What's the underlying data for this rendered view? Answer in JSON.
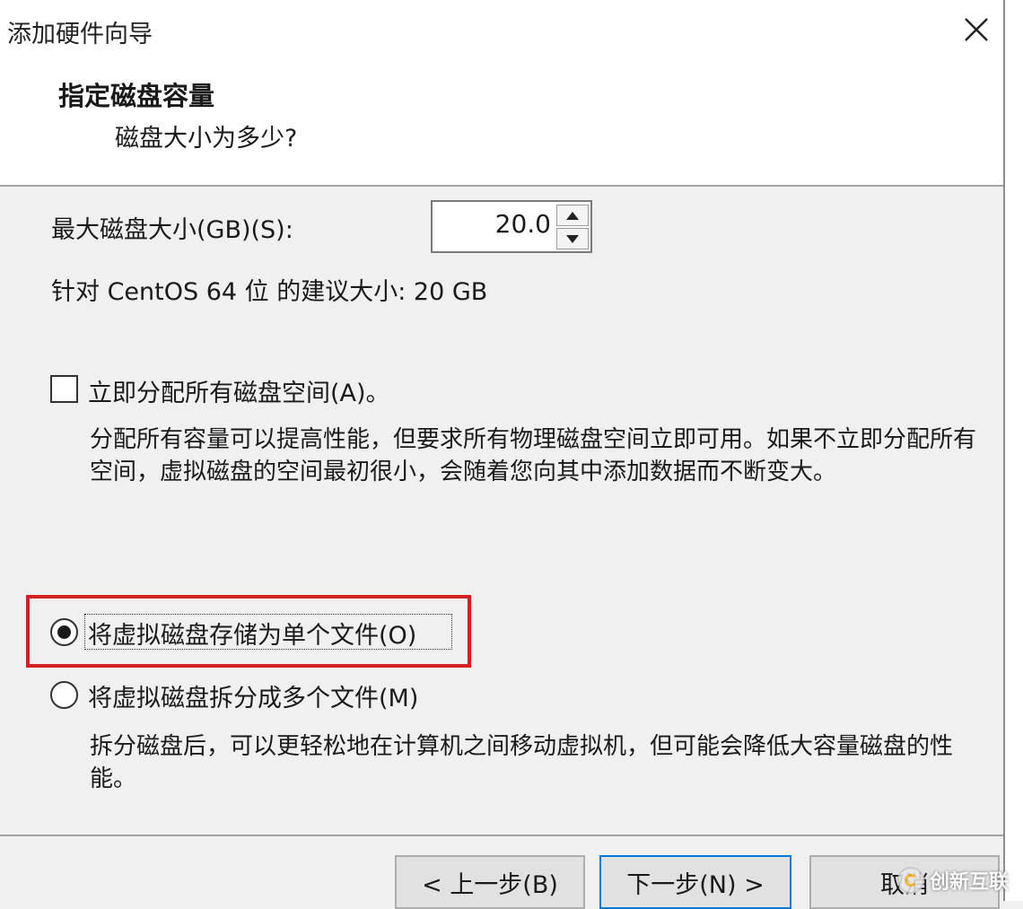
{
  "window": {
    "title": "添加硬件向导",
    "close_icon": "close-icon"
  },
  "header": {
    "title": "指定磁盘容量",
    "subtitle": "磁盘大小为多少?"
  },
  "disk_size": {
    "label": "最大磁盘大小(GB)(S):",
    "value": "20.0",
    "recommendation": "针对 CentOS 64 位 的建议大小: 20 GB"
  },
  "allocate": {
    "checked": false,
    "label": "立即分配所有磁盘空间(A)。",
    "description": "分配所有容量可以提高性能，但要求所有物理磁盘空间立即可用。如果不立即分配所有空间，虚拟磁盘的空间最初很小，会随着您向其中添加数据而不断变大。"
  },
  "storage_options": [
    {
      "label": "将虚拟磁盘存储为单个文件(O)",
      "selected": true
    },
    {
      "label": "将虚拟磁盘拆分成多个文件(M)",
      "selected": false,
      "description": "拆分磁盘后，可以更轻松地在计算机之间移动虚拟机，但可能会降低大容量磁盘的性能。"
    }
  ],
  "buttons": {
    "back": "< 上一步(B)",
    "next": "下一步(N) >",
    "cancel": "取消"
  },
  "watermark": {
    "text": "创新互联"
  },
  "colors": {
    "highlight_box": "#d42020",
    "focus_border": "#0078d7",
    "window_bg": "#f0f0f0"
  }
}
